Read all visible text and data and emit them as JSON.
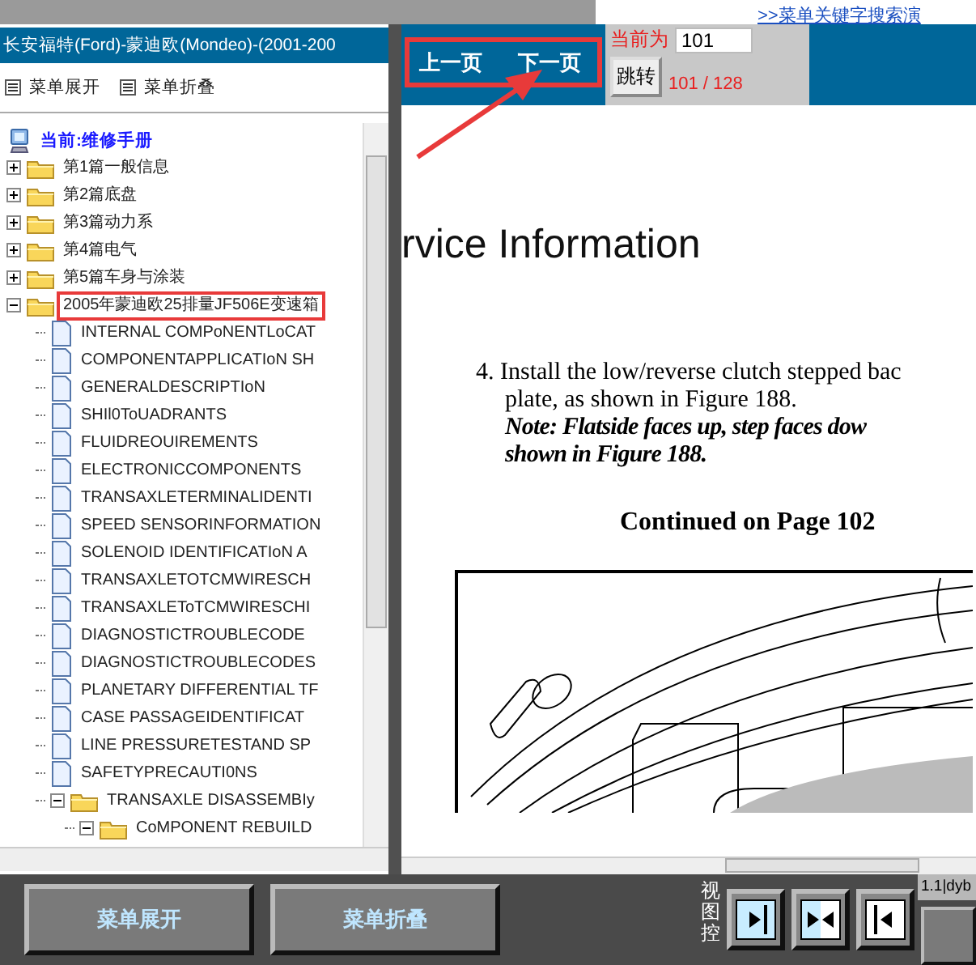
{
  "banner": {
    "link": ">>菜单关键字搜索演"
  },
  "sidebar": {
    "title": "长安福特(Ford)-蒙迪欧(Mondeo)-(2001-200",
    "toolbar": [
      "菜单展开",
      "菜单折叠"
    ],
    "tree": {
      "label": "当前:维修手册",
      "kind": "root",
      "children": [
        {
          "label": "第1篇一般信息",
          "kind": "folder",
          "expanded": false,
          "highlighted": false
        },
        {
          "label": "第2篇底盘",
          "kind": "folder",
          "expanded": false,
          "highlighted": false
        },
        {
          "label": "第3篇动力系",
          "kind": "folder",
          "expanded": false,
          "highlighted": false
        },
        {
          "label": "第4篇电气",
          "kind": "folder",
          "expanded": false,
          "highlighted": false
        },
        {
          "label": "第5篇车身与涂装",
          "kind": "folder",
          "expanded": false,
          "highlighted": false
        },
        {
          "label": "2005年蒙迪欧25排量JF506E变速箱",
          "kind": "folder",
          "expanded": true,
          "highlighted": true,
          "children": [
            {
              "label": "INTERNAL COMPoNENTLoCAT",
              "kind": "doc",
              "highlighted": false
            },
            {
              "label": "COMPONENTAPPLICATIoN SH",
              "kind": "doc",
              "highlighted": false
            },
            {
              "label": "GENERALDESCRIPTIoN",
              "kind": "doc",
              "highlighted": false
            },
            {
              "label": "SHIl0ToUADRANTS",
              "kind": "doc",
              "highlighted": false
            },
            {
              "label": "FLUIDREOUIREMENTS",
              "kind": "doc",
              "highlighted": false
            },
            {
              "label": "ELECTRONICCOMPONENTS",
              "kind": "doc",
              "highlighted": false
            },
            {
              "label": "TRANSAXLETERMINALIDENTI",
              "kind": "doc",
              "highlighted": false
            },
            {
              "label": "SPEED SENSORINFORMATION",
              "kind": "doc",
              "highlighted": false
            },
            {
              "label": "SOLENOID IDENTIFICATIoN A",
              "kind": "doc",
              "highlighted": false
            },
            {
              "label": "TRANSAXLETOTCMWIRESCH",
              "kind": "doc",
              "highlighted": false
            },
            {
              "label": "TRANSAXLEToTCMWIRESCHI",
              "kind": "doc",
              "highlighted": false
            },
            {
              "label": "DIAGNOSTICTROUBLECODE",
              "kind": "doc",
              "highlighted": false
            },
            {
              "label": "DIAGNOSTICTROUBLECODES",
              "kind": "doc",
              "highlighted": false
            },
            {
              "label": "PLANETARY DIFFERENTIAL TF",
              "kind": "doc",
              "highlighted": false
            },
            {
              "label": "CASE PASSAGEIDENTIFICAT",
              "kind": "doc",
              "highlighted": false
            },
            {
              "label": "LINE PRESSURETESTAND SP",
              "kind": "doc",
              "highlighted": false
            },
            {
              "label": "SAFETYPRECAUTI0NS",
              "kind": "doc",
              "highlighted": false
            },
            {
              "label": "TRANSAXLE DISASSEMBIy",
              "kind": "folder",
              "expanded": true,
              "highlighted": false,
              "children": [
                {
                  "label": "CoMPONENT REBUILD",
                  "kind": "folder",
                  "expanded": true,
                  "highlighted": false
                }
              ]
            }
          ]
        }
      ]
    }
  },
  "navigation": {
    "buttons": [
      "上一页",
      "下一页"
    ],
    "annotated": true,
    "current_label": "当前为",
    "page_input": "101",
    "jump_button": "跳转",
    "page_count": "101 / 128"
  },
  "document": {
    "heading": "rvice Information",
    "step": "4. Install the low/reverse clutch stepped bac",
    "step_cont": "plate, as shown in Figure 188.",
    "note": [
      "Note: Flatside faces up, step faces dow",
      "shown in Figure 188."
    ],
    "continued": "Continued on Page 102"
  },
  "bottom_bar": {
    "buttons": [
      "菜单展开",
      "菜单折叠"
    ],
    "view_label": "视图控",
    "view_buttons": [
      {
        "kind": "right"
      },
      {
        "kind": "both"
      },
      {
        "kind": "left"
      }
    ],
    "version": "1.1|dyb"
  }
}
